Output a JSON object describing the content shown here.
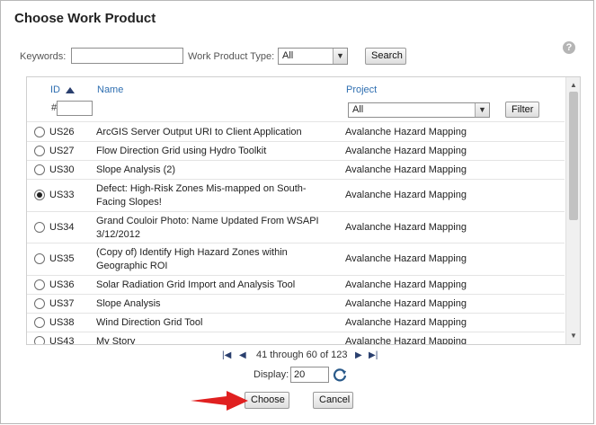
{
  "dialog": {
    "title": "Choose Work Product",
    "help_glyph": "?"
  },
  "filters": {
    "keywords_label": "Keywords:",
    "keywords_value": "",
    "wp_type_label": "Work Product Type:",
    "wp_type_value": "All",
    "search_button": "Search"
  },
  "grid": {
    "columns": {
      "id": "ID",
      "name": "Name",
      "project": "Project"
    },
    "id_filter_prefix": "#",
    "id_filter_value": "",
    "project_filter_value": "All",
    "filter_button": "Filter",
    "rows": [
      {
        "id": "US26",
        "name": "ArcGIS Server Output URI to Client Application",
        "project": "Avalanche Hazard Mapping",
        "selected": false
      },
      {
        "id": "US27",
        "name": "Flow Direction Grid using Hydro Toolkit",
        "project": "Avalanche Hazard Mapping",
        "selected": false
      },
      {
        "id": "US30",
        "name": "Slope Analysis (2)",
        "project": "Avalanche Hazard Mapping",
        "selected": false
      },
      {
        "id": "US33",
        "name": "Defect: High-Risk Zones Mis-mapped on South-Facing Slopes!",
        "project": "Avalanche Hazard Mapping",
        "selected": true
      },
      {
        "id": "US34",
        "name": "Grand Couloir Photo: Name Updated From WSAPI 3/12/2012",
        "project": "Avalanche Hazard Mapping",
        "selected": false
      },
      {
        "id": "US35",
        "name": "(Copy of) Identify High Hazard Zones within Geographic ROI",
        "project": "Avalanche Hazard Mapping",
        "selected": false
      },
      {
        "id": "US36",
        "name": "Solar Radiation Grid Import and Analysis Tool",
        "project": "Avalanche Hazard Mapping",
        "selected": false
      },
      {
        "id": "US37",
        "name": "Slope Analysis",
        "project": "Avalanche Hazard Mapping",
        "selected": false
      },
      {
        "id": "US38",
        "name": "Wind Direction Grid Tool",
        "project": "Avalanche Hazard Mapping",
        "selected": false
      },
      {
        "id": "US43",
        "name": "My Story",
        "project": "Avalanche Hazard Mapping",
        "selected": false
      }
    ]
  },
  "pager": {
    "range_text": "41 through 60 of 123",
    "display_label": "Display:",
    "display_value": "20"
  },
  "actions": {
    "choose_label": "Choose",
    "cancel_label": "Cancel"
  },
  "colors": {
    "link": "#2f6fb1",
    "annotation_arrow": "#e02020"
  },
  "icons": [
    "help-icon",
    "sort-ascending-icon",
    "dropdown-arrow-icon",
    "first-page-icon",
    "prev-page-icon",
    "next-page-icon",
    "last-page-icon",
    "refresh-icon",
    "annotation-arrow-icon"
  ]
}
